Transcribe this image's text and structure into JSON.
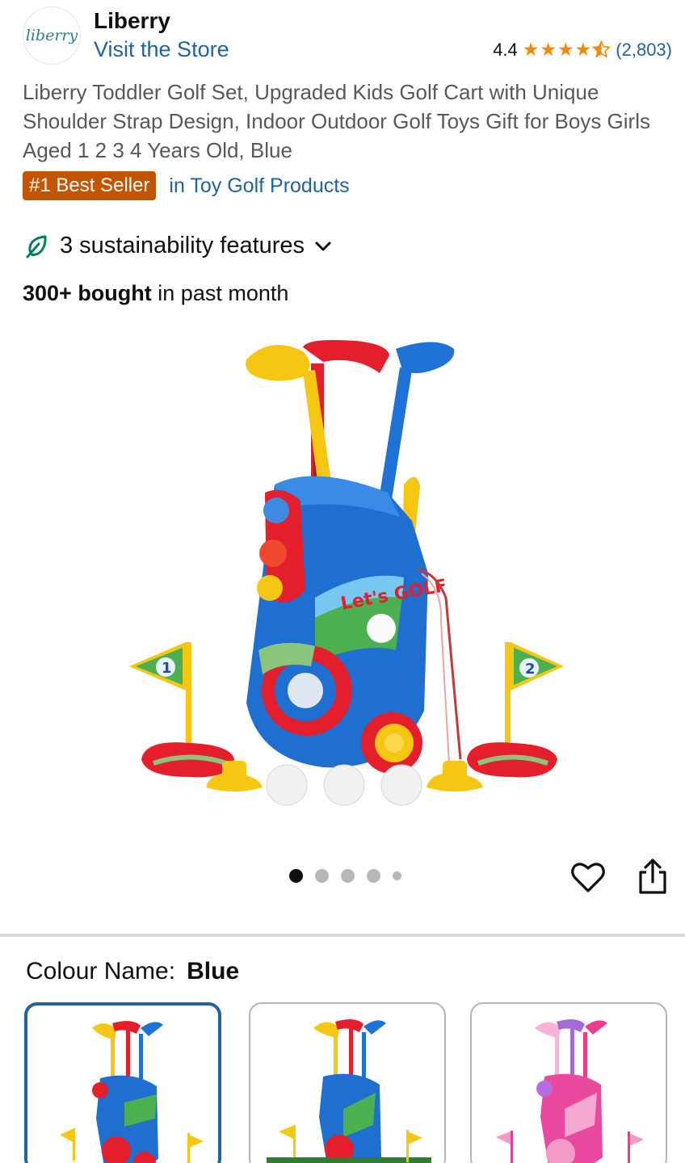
{
  "store": {
    "logo_text": "liberry",
    "brand": "Liberry",
    "visit_store": "Visit the Store",
    "rating": "4.4",
    "stars_value": 4.4,
    "rating_count": "(2,803)"
  },
  "product": {
    "title": "Liberry Toddler Golf Set, Upgraded Kids Golf Cart with Unique Shoulder Strap Design, Indoor Outdoor Golf Toys Gift for Boys Girls Aged 1 2 3 4 Years Old, Blue",
    "badge": "#1 Best Seller",
    "badge_category": "in Toy Golf Products",
    "sustainability": "3 sustainability features",
    "bought_bold": "300+ bought",
    "bought_rest": " in past month",
    "image_text": "Let's GOLF",
    "flag_1": "1",
    "flag_2": "2"
  },
  "carousel": {
    "total_dots": 5,
    "active_index": 0
  },
  "colour": {
    "label": "Colour Name:",
    "selected": "Blue"
  },
  "colors": {
    "link": "#2162a1",
    "star": "#f08804",
    "badge_bg": "#c45500",
    "leaf": "#067d62"
  },
  "icons": [
    "leaf-icon",
    "chevron-down-icon",
    "heart-icon",
    "share-icon"
  ]
}
